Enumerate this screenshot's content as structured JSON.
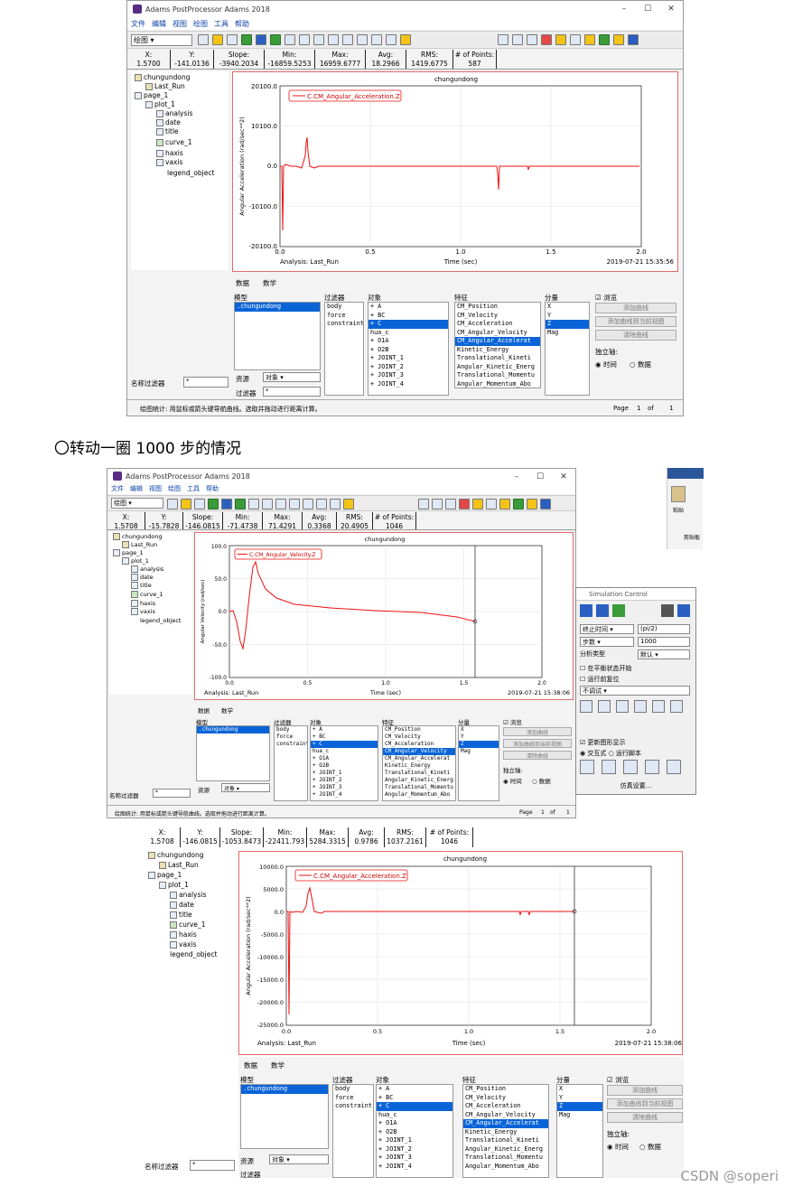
{
  "app": {
    "title1": "Adams PostProcessor Adams 2018",
    "title2": "Adams PostProcessor Adams 2018",
    "min": "–",
    "max": "☐",
    "close": "✕"
  },
  "menu": [
    "文件",
    "编辑",
    "视图",
    "绘图",
    "工具",
    "帮助"
  ],
  "toolbar": {
    "mode": "绘图"
  },
  "stats1": {
    "labels": [
      "X:",
      "Y:",
      "Slope:",
      "Min:",
      "Max:",
      "Avg:",
      "RMS:",
      "# of Points:"
    ],
    "values": [
      "1.5700",
      "-141.0136",
      "-3940.2034",
      "-16859.5253",
      "16959.6777",
      "18.2966",
      "1419.6775",
      "587"
    ]
  },
  "stats2": {
    "labels": [
      "X:",
      "Y:",
      "Slope:",
      "Min:",
      "Max:",
      "Avg:",
      "RMS:",
      "# of Points:"
    ],
    "values": [
      "1.5708",
      "-15.7828",
      "-146.0815",
      "-71.4738",
      "71.4291",
      "0.3368",
      "20.4905",
      "1046"
    ]
  },
  "stats3": {
    "labels": [
      "X:",
      "Y:",
      "Slope:",
      "Min:",
      "Max:",
      "Avg:",
      "RMS:",
      "# of Points:"
    ],
    "values": [
      "1.5708",
      "-146.0815",
      "-1053.8473",
      "-22411.793",
      "5284.3315",
      "0.9786",
      "1037.2161",
      "1046"
    ]
  },
  "tree": {
    "root": "chungundong",
    "run": "Last_Run",
    "page": "page_1",
    "plot": "plot_1",
    "items": [
      "analysis",
      "date",
      "title",
      "curve_1",
      "haxis",
      "vaxis"
    ],
    "legend": "legend_object"
  },
  "plot": {
    "title": "chungundong",
    "analysis": "Analysis:  Last_Run",
    "xlabel": "Time (sec)",
    "date1": "2019-07-21 15:35:56",
    "date2": "2019-07-21 15:38:06",
    "date3": "2019-07-21 15:38:06",
    "legend1": "C.CM_Angular_Acceleration.Z",
    "legend2": "C.CM_Angular_Velocity.Z",
    "legend3": "C.CM_Angular_Acceleration.Z",
    "ylabel_acc": "Angular Acceleration (rad/sec**2)",
    "ylabel_vel": "Angular Velocity (rad/sec)",
    "y1ticks": [
      "20100.0",
      "10100.0",
      "0.0",
      "-10100.0",
      "-20100.0"
    ],
    "y2ticks": [
      "100.0",
      "50.0",
      "0.0",
      "-50.0",
      "-100.0"
    ],
    "y3ticks": [
      "10000.0",
      "5000.0",
      "0.0",
      "-5000.0",
      "-10000.0",
      "-15000.0",
      "-20000.0",
      "-25000.0"
    ],
    "xticks": [
      "0.0",
      "0.5",
      "1.0",
      "1.5",
      "2.0"
    ]
  },
  "panel": {
    "tab_data": "数据",
    "tab_math": "数学",
    "model_label": "模型",
    "filter_label": "过滤器",
    "object_label": "对象",
    "feature_label": "特征",
    "component_label": "分量",
    "browse_label": "浏览",
    "model_item": ".chungundong",
    "filters": [
      "body",
      "force",
      "constraint"
    ],
    "objects": [
      "+ A",
      "+ BC",
      "+ C",
      "hua_c",
      "+ O1A",
      "+ O2B",
      "+ JOINT_1",
      "+ JOINT_2",
      "+ JOINT_3",
      "+ JOINT_4"
    ],
    "features": [
      "CM_Position",
      "CM_Velocity",
      "CM_Acceleration",
      "CM_Angular_Velocity",
      "CM_Angular_Accelerat",
      "Kinetic_Energy",
      "Translational_Kineti",
      "Angular_Kinetic_Energ",
      "Translational_Momentu",
      "Angular_Momentum_Abo"
    ],
    "components": [
      "X",
      "Y",
      "Z",
      "Mag"
    ],
    "add_curve": "添加曲线",
    "add_to_current": "添加曲线到当前视图",
    "clear_curve": "清除曲线",
    "indep_axis": "独立轴:",
    "time": "时间",
    "data": "数据",
    "source_label": "资源",
    "source_value": "对象",
    "filter2_label": "过滤器",
    "name_filter": "名称过滤器",
    "name_filter_value": "*"
  },
  "status": {
    "text": "绘图统计: 用鼠标或箭头键导航曲线。选取并拖动进行距离计算。",
    "page": "Page",
    "page_no": "1",
    "of": "of",
    "total": "1"
  },
  "caption": "〇转动一圈 1000 步的情况",
  "sim": {
    "title": "Simulation Control",
    "end": "终止时间",
    "end_val": "(pi/2)",
    "steps": "步数",
    "steps_val": "1000",
    "type": "分析类型",
    "type_val": "默认",
    "opt1": "在平衡状态开始",
    "opt2": "运行前复位",
    "debug": "不调试",
    "opt3": "更新图形显示",
    "interactive": "交互式",
    "script": "运行脚本",
    "settings": "仿真设置..."
  },
  "side": {
    "paste": "粘贴",
    "clipboard": "剪贴板"
  },
  "watermark": "CSDN @soperi"
}
